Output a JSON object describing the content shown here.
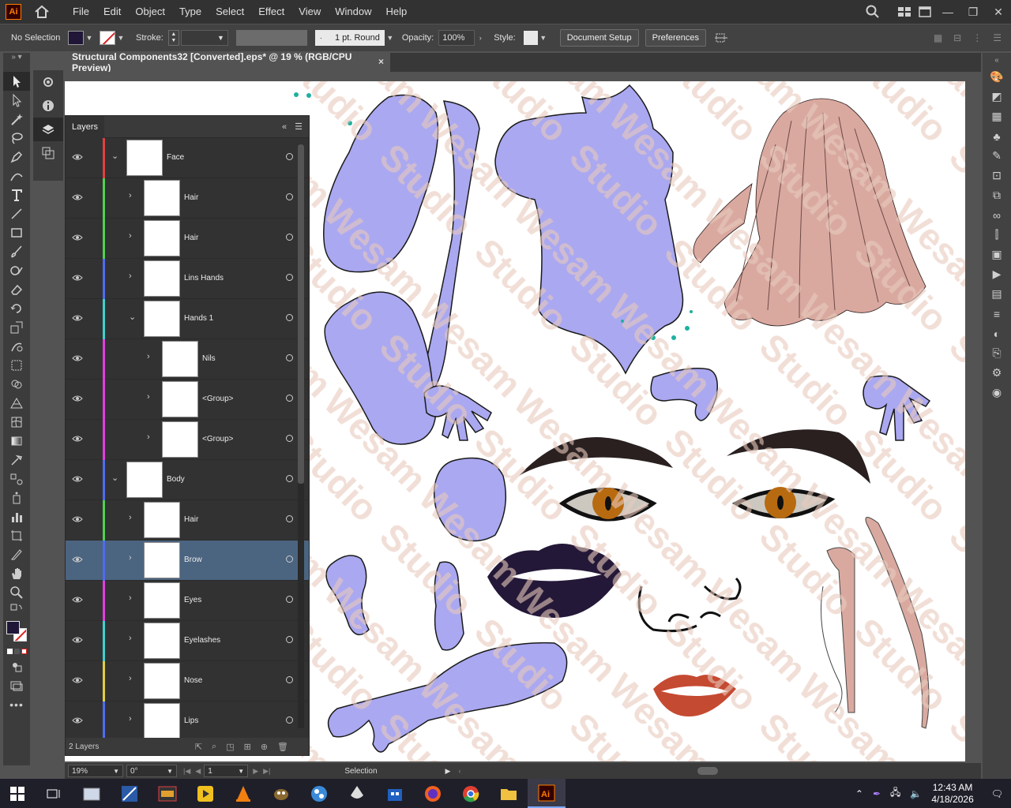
{
  "app": {
    "logo_text": "Ai",
    "menu": [
      "File",
      "Edit",
      "Object",
      "Type",
      "Select",
      "Effect",
      "View",
      "Window",
      "Help"
    ]
  },
  "control_bar": {
    "selection_text": "No Selection",
    "stroke_label": "Stroke:",
    "stroke_style": "1 pt. Round",
    "opacity_label": "Opacity:",
    "opacity_value": "100%",
    "style_label": "Style:",
    "document_setup": "Document Setup",
    "preferences": "Preferences",
    "fill_color": "#1f1638"
  },
  "document_tab": {
    "title": "Structural Components32 [Converted].eps* @ 19 % (RGB/CPU Preview)",
    "close": "×"
  },
  "layers_panel": {
    "title": "Layers",
    "rows": [
      {
        "name": "Face",
        "color": "#e04040",
        "level": 0,
        "expanded": true
      },
      {
        "name": "Hair",
        "color": "#50d050",
        "level": 1,
        "expanded": false
      },
      {
        "name": "Hair",
        "color": "#50d050",
        "level": 1,
        "expanded": false
      },
      {
        "name": "Lins Hands",
        "color": "#4f6cf0",
        "level": 1,
        "expanded": false
      },
      {
        "name": "Hands 1",
        "color": "#40d0d0",
        "level": 1,
        "expanded": true
      },
      {
        "name": "Nils",
        "color": "#e040e0",
        "level": 2,
        "expanded": false
      },
      {
        "name": "<Group>",
        "color": "#e040e0",
        "level": 2,
        "expanded": false
      },
      {
        "name": "<Group>",
        "color": "#e040e0",
        "level": 2,
        "expanded": false
      },
      {
        "name": "Body",
        "color": "#4f6cf0",
        "level": 0,
        "expanded": true
      },
      {
        "name": "Hair",
        "color": "#50d050",
        "level": 1,
        "expanded": false
      },
      {
        "name": "Brow",
        "color": "#4f6cf0",
        "level": 1,
        "expanded": false,
        "selected": true
      },
      {
        "name": "Eyes",
        "color": "#e040e0",
        "level": 1,
        "expanded": false
      },
      {
        "name": "Eyelashes",
        "color": "#40d0d0",
        "level": 1,
        "expanded": false
      },
      {
        "name": "Nose",
        "color": "#e0d040",
        "level": 1,
        "expanded": false
      },
      {
        "name": "Lips",
        "color": "#4f6cf0",
        "level": 1,
        "expanded": false
      }
    ],
    "footer_count": "2 Layers"
  },
  "status_bar": {
    "zoom": "19%",
    "rotation": "0°",
    "artboard": "1",
    "tool": "Selection"
  },
  "taskbar": {
    "time": "12:43 AM",
    "date": "4/18/2026"
  }
}
